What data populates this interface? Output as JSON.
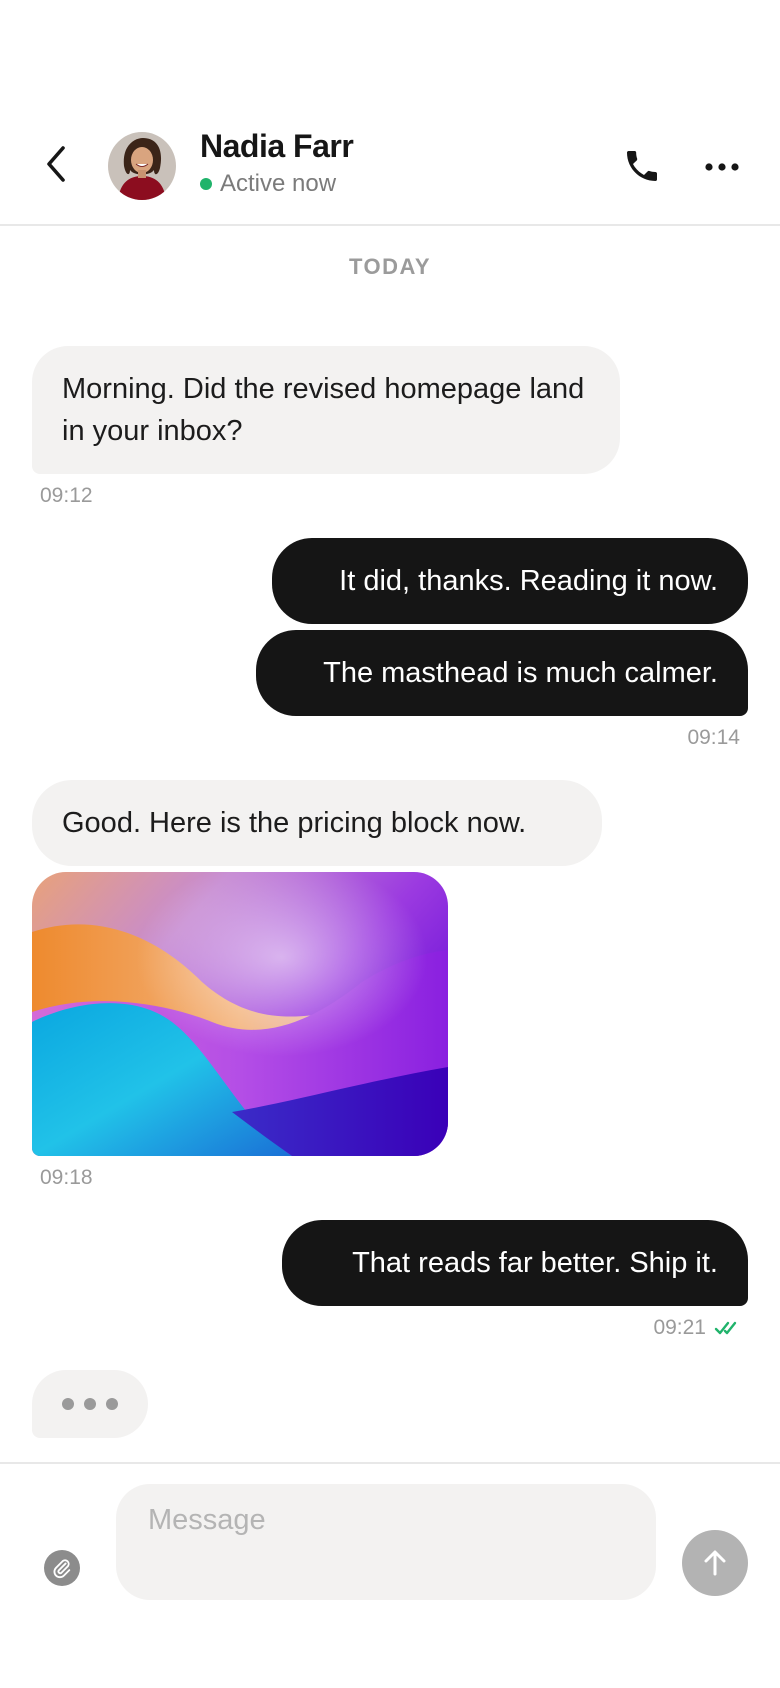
{
  "header": {
    "contact_name": "Nadia Farr",
    "presence": "Active now",
    "presence_color": "#20b36b",
    "icons": {
      "back": "chevron-left-icon",
      "call": "phone-icon",
      "more": "more-horizontal-icon"
    }
  },
  "conversation": {
    "date_label": "TODAY",
    "messages": [
      {
        "direction": "incoming",
        "text": "Morning. Did the revised homepage land in your inbox?",
        "time": "09:12"
      },
      {
        "direction": "outgoing",
        "text": "It did, thanks. Reading it now."
      },
      {
        "direction": "outgoing",
        "text": "The masthead is much calmer.",
        "time": "09:14"
      },
      {
        "direction": "incoming",
        "text": "Good. Here is the pricing block now."
      },
      {
        "direction": "incoming",
        "type": "image",
        "time": "09:18"
      },
      {
        "direction": "outgoing",
        "text": "That reads far better. Ship it.",
        "time": "09:21",
        "status": "read"
      }
    ],
    "typing_indicator": true
  },
  "composer": {
    "placeholder": "Message",
    "value": "",
    "icons": {
      "attach": "paperclip-icon",
      "send": "arrow-up-icon"
    }
  },
  "colors": {
    "incoming_bubble": "#f3f2f1",
    "outgoing_bubble": "#151515",
    "read_receipt": "#20b36b",
    "send_button": "#b3b3b3"
  }
}
